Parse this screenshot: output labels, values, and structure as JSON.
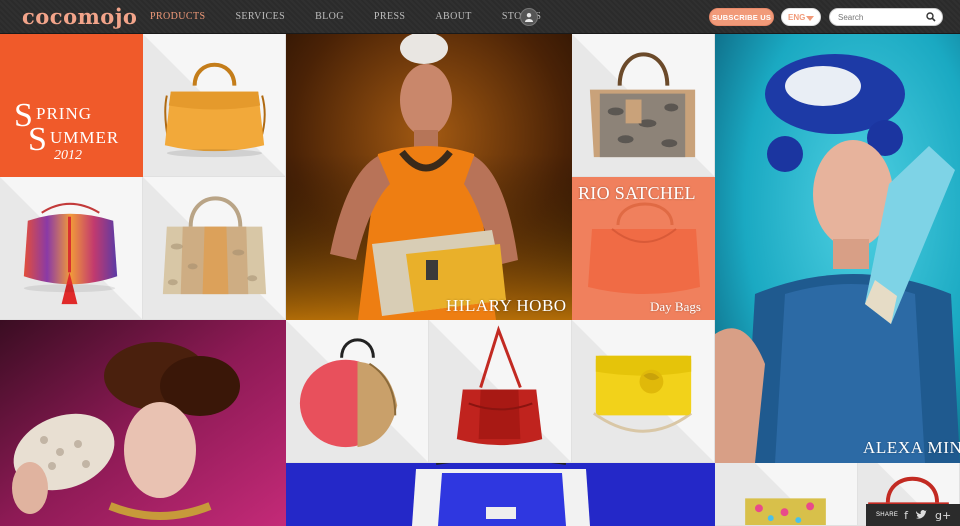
{
  "header": {
    "logo": "cocomojo",
    "nav": [
      {
        "label": "PRODUCTS",
        "active": true
      },
      {
        "label": "SERVICES",
        "active": false
      },
      {
        "label": "BLOG",
        "active": false
      },
      {
        "label": "PRESS",
        "active": false
      },
      {
        "label": "ABOUT",
        "active": false
      },
      {
        "label": "STORES",
        "active": false
      }
    ],
    "subscribe_label": "SUBSCRIBE US",
    "language": "ENG",
    "search_placeholder": "Search"
  },
  "tiles": {
    "spring_summer": {
      "s": "S",
      "line1": "PRING",
      "line2": "UMMER",
      "year": "2012"
    },
    "hilary_hobo": "HILARY HOBO",
    "rio_satchel": {
      "title": "RIO SATCHEL",
      "subtitle": "Day Bags"
    },
    "alexa": "ALEXA MINI"
  },
  "share": {
    "label": "SHARE",
    "icons": [
      "f",
      "t",
      "g+"
    ]
  },
  "colors": {
    "accent": "#f19a79",
    "orange_tile": "#f05a2a",
    "salmon_tile": "#f0805d",
    "teal": "#1aa9c2",
    "magenta": "#a01f67",
    "royal_blue": "#2a2bd1"
  }
}
